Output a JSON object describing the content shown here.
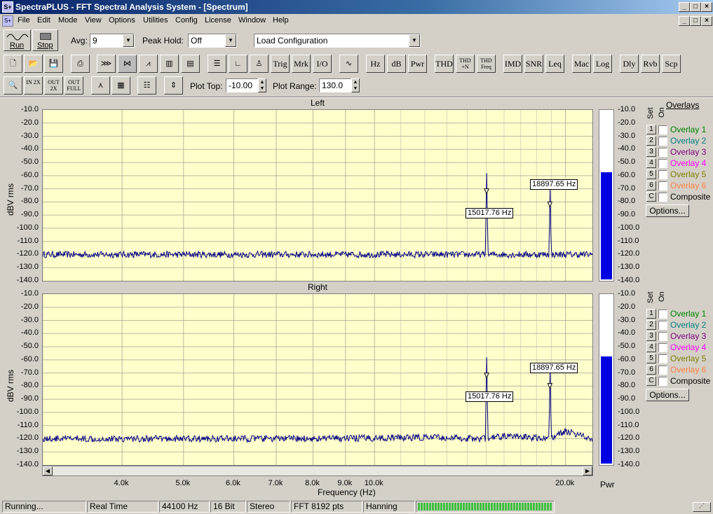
{
  "window": {
    "title": "SpectraPLUS - FFT Spectral Analysis System - [Spectrum]",
    "app_icon": "spectrum-app-icon",
    "controls": [
      "_",
      "□",
      "×"
    ],
    "child_controls": [
      "_",
      "□",
      "×"
    ]
  },
  "menu": [
    "File",
    "Edit",
    "Mode",
    "View",
    "Options",
    "Utilities",
    "Config",
    "License",
    "Window",
    "Help"
  ],
  "toolbar1": {
    "run_label": "Run",
    "stop_label": "Stop",
    "avg_label": "Avg:",
    "avg_value": "9",
    "peak_hold_label": "Peak Hold:",
    "peak_hold_value": "Off",
    "config_value": "Load Configuration"
  },
  "toolbar2": {
    "buttons": [
      "Trig",
      "Mrk",
      "I/O",
      "Hz",
      "dB",
      "Pwr",
      "THD",
      "THD +N",
      "THD Freq",
      "IMD",
      "SNR",
      "Leq",
      "Mac",
      "Log",
      "Dly",
      "Rvb",
      "Scp"
    ]
  },
  "toolbar3": {
    "zoom_in": "IN 2X",
    "zoom_out": "OUT 2X",
    "zoom_full": "OUT FULL",
    "plot_top_label": "Plot Top:",
    "plot_top_value": "-10.00",
    "plot_range_label": "Plot Range:",
    "plot_range_value": "130.0"
  },
  "channels": [
    {
      "title": "Left",
      "ylabel": "dBV rms",
      "markers": [
        "15017.76 Hz",
        "18897.65 Hz"
      ],
      "meter_level_db": -57,
      "meter_label": ""
    },
    {
      "title": "Right",
      "ylabel": "dBV rms",
      "markers": [
        "15017.76 Hz",
        "18897.65 Hz"
      ],
      "meter_level_db": -57,
      "meter_label": "Pwr"
    }
  ],
  "yticks": [
    "-10.0",
    "-20.0",
    "-30.0",
    "-40.0",
    "-50.0",
    "-60.0",
    "-70.0",
    "-80.0",
    "-90.0",
    "-100.0",
    "-110.0",
    "-120.0",
    "-130.0",
    "-140.0"
  ],
  "xaxis": {
    "label": "Frequency (Hz)",
    "ticks": [
      "4.0k",
      "5.0k",
      "6.0k",
      "7.0k",
      "8.0k",
      "9.0k",
      "10.0k",
      "20.0k"
    ]
  },
  "overlays": {
    "header": "Overlays",
    "set_label": "Set",
    "on_label": "On",
    "items": [
      {
        "num": "1",
        "label": "Overlay 1",
        "color": "#008000"
      },
      {
        "num": "2",
        "label": "Overlay 2",
        "color": "#008080"
      },
      {
        "num": "3",
        "label": "Overlay 3",
        "color": "#800080"
      },
      {
        "num": "4",
        "label": "Overlay 4",
        "color": "#ff00ff"
      },
      {
        "num": "5",
        "label": "Overlay 5",
        "color": "#808000"
      },
      {
        "num": "6",
        "label": "Overlay 6",
        "color": "#ff8040"
      },
      {
        "num": "C",
        "label": "Composite",
        "color": "#000000"
      }
    ],
    "options_label": "Options..."
  },
  "status": {
    "state": "Running...",
    "mode": "Real Time",
    "rate": "44100 Hz",
    "bits": "16 Bit",
    "channels": "Stereo",
    "fft": "FFT 8192 pts",
    "window": "Hanning"
  },
  "colors": {
    "trace": "#000080",
    "plot_bg": "#ffffcc",
    "meter": "#0000e0",
    "status_meter": "#40c040"
  },
  "chart_data": [
    {
      "type": "line",
      "title": "Left",
      "xlabel": "Frequency (Hz)",
      "ylabel": "dBV rms",
      "xscale": "log",
      "xlim": [
        3000,
        22050
      ],
      "ylim": [
        -140,
        -10
      ],
      "grid": true,
      "series": [
        {
          "x": [
            3000,
            5000,
            8000,
            12000,
            15017.76,
            16000,
            18897.65,
            21000,
            22050
          ],
          "y": [
            -120,
            -120,
            -120,
            -120,
            -58,
            -120,
            -68,
            -120,
            -120
          ]
        }
      ],
      "annotations": [
        "15017.76 Hz",
        "18897.65 Hz"
      ]
    },
    {
      "type": "line",
      "title": "Right",
      "xlabel": "Frequency (Hz)",
      "ylabel": "dBV rms",
      "xscale": "log",
      "xlim": [
        3000,
        22050
      ],
      "ylim": [
        -140,
        -10
      ],
      "grid": true,
      "series": [
        {
          "x": [
            3000,
            5000,
            8000,
            12000,
            15017.76,
            16000,
            18897.65,
            20000,
            22050
          ],
          "y": [
            -120,
            -120,
            -120,
            -119,
            -58,
            -118,
            -66,
            -114,
            -120
          ]
        }
      ],
      "annotations": [
        "15017.76 Hz",
        "18897.65 Hz"
      ]
    }
  ]
}
